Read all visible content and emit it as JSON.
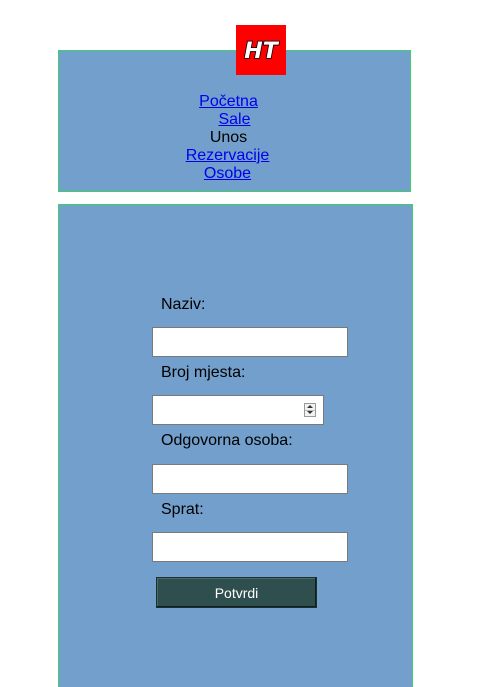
{
  "logo": {
    "text": "HT",
    "background": "#ff0000"
  },
  "nav": {
    "items": [
      {
        "label": "Početna",
        "link": true
      },
      {
        "label": "Sale",
        "link": true
      },
      {
        "label": "Unos",
        "link": false
      },
      {
        "label": "Rezervacije",
        "link": true
      },
      {
        "label": "Osobe",
        "link": true
      }
    ]
  },
  "form": {
    "fields": [
      {
        "label": "Naziv:",
        "value": ""
      },
      {
        "label": "Broj mjesta:",
        "value": ""
      },
      {
        "label": "Odgovorna osoba:",
        "value": ""
      },
      {
        "label": "Sprat:",
        "value": ""
      }
    ],
    "submit_label": "Potvrdi"
  },
  "colors": {
    "panel": "#729fcb",
    "panel_border": "#3fcf6a",
    "button": "#2f4f4f",
    "link": "#0000ee"
  }
}
